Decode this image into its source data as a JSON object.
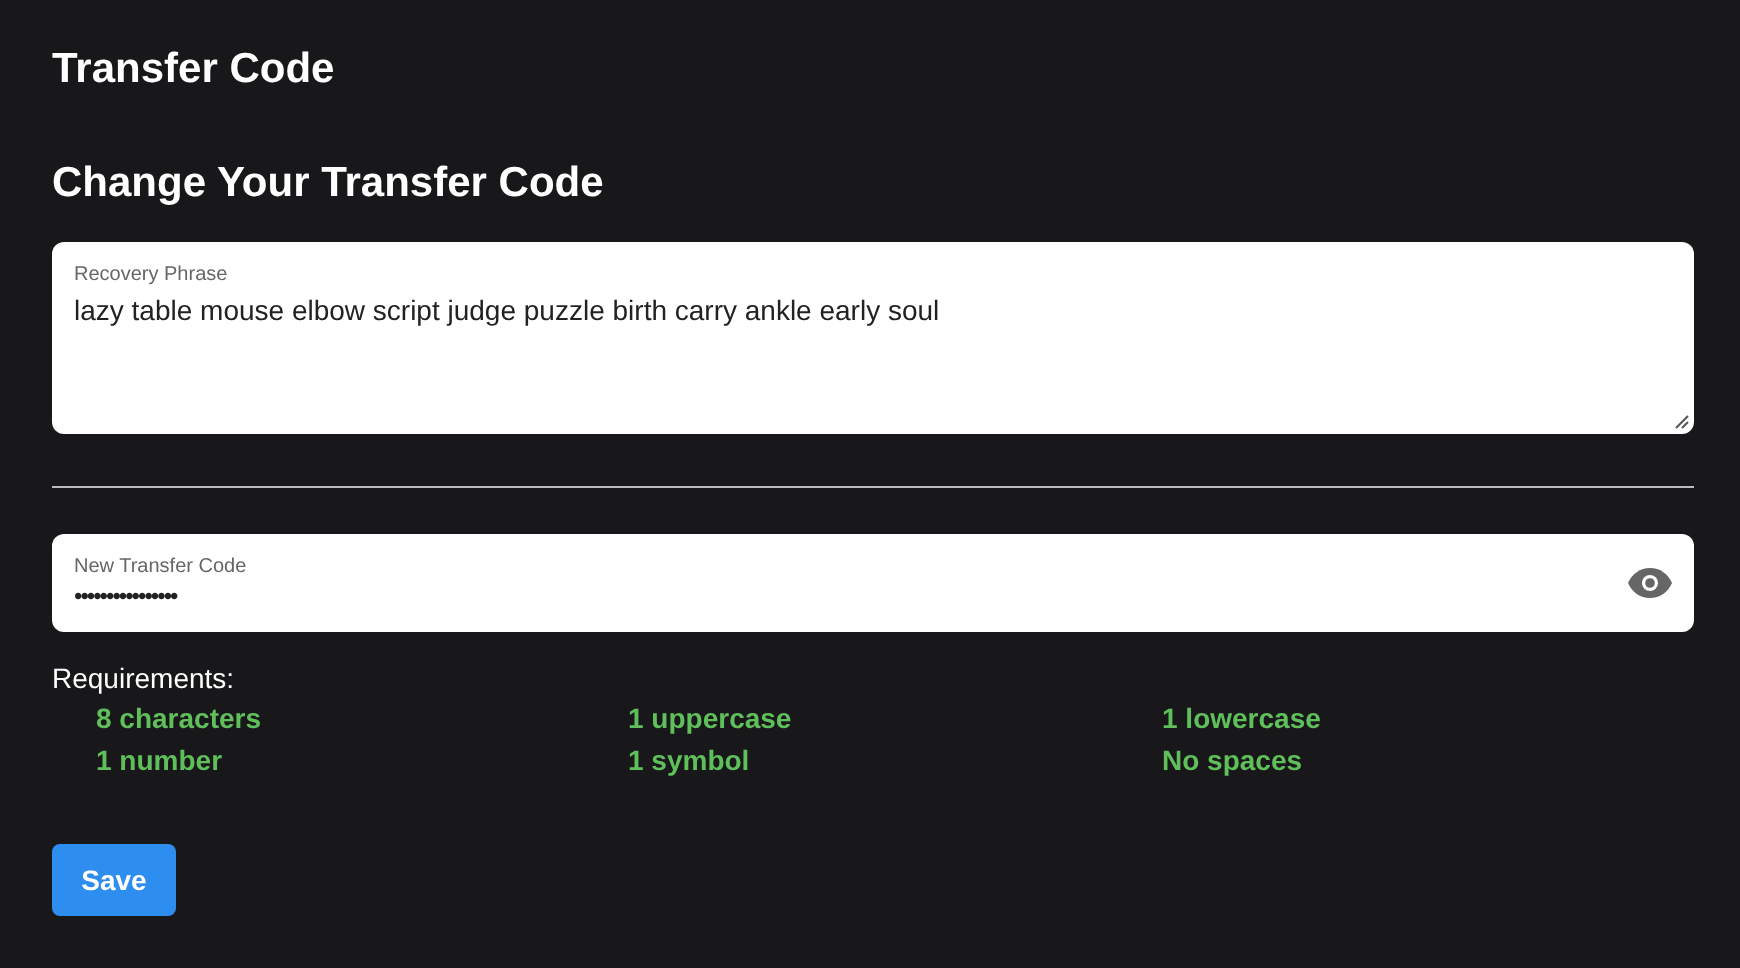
{
  "page_title": "Transfer Code",
  "section_title": "Change Your Transfer Code",
  "recovery_phrase": {
    "label": "Recovery Phrase",
    "value": "lazy table mouse elbow script judge puzzle birth carry ankle early soul"
  },
  "new_code": {
    "label": "New Transfer Code",
    "value": "••••••••••••••••"
  },
  "requirements": {
    "title": "Requirements:",
    "items": [
      {
        "text": "8 characters",
        "met": true
      },
      {
        "text": "1 uppercase",
        "met": true
      },
      {
        "text": "1 lowercase",
        "met": true
      },
      {
        "text": "1 number",
        "met": true
      },
      {
        "text": "1 symbol",
        "met": true
      },
      {
        "text": "No spaces",
        "met": true
      }
    ]
  },
  "save_button": "Save"
}
